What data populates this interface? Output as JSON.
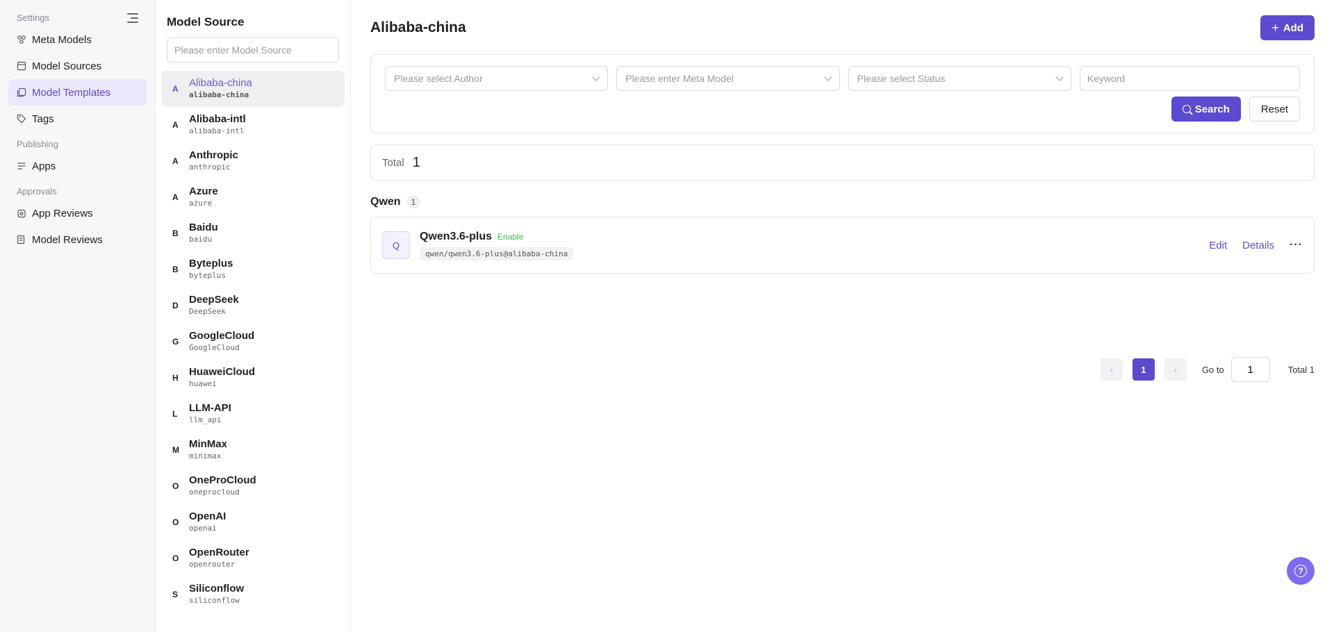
{
  "nav": {
    "settings_label": "Settings",
    "publishing_label": "Publishing",
    "approvals_label": "Approvals",
    "items": {
      "meta_models": "Meta Models",
      "model_sources": "Model Sources",
      "model_templates": "Model Templates",
      "tags": "Tags",
      "apps": "Apps",
      "app_reviews": "App Reviews",
      "model_reviews": "Model Reviews"
    },
    "active": "Model Templates"
  },
  "source_panel": {
    "title": "Model Source",
    "search_placeholder": "Please enter Model Source",
    "sources": [
      {
        "letter": "A",
        "name": "Alibaba-china",
        "code": "alibaba-china",
        "active": true
      },
      {
        "letter": "A",
        "name": "Alibaba-intl",
        "code": "alibaba-intl"
      },
      {
        "letter": "A",
        "name": "Anthropic",
        "code": "anthropic"
      },
      {
        "letter": "A",
        "name": "Azure",
        "code": "azure"
      },
      {
        "letter": "B",
        "name": "Baidu",
        "code": "baidu"
      },
      {
        "letter": "B",
        "name": "Byteplus",
        "code": "byteplus"
      },
      {
        "letter": "D",
        "name": "DeepSeek",
        "code": "DeepSeek"
      },
      {
        "letter": "G",
        "name": "GoogleCloud",
        "code": "GoogleCloud"
      },
      {
        "letter": "H",
        "name": "HuaweiCloud",
        "code": "huawei"
      },
      {
        "letter": "L",
        "name": "LLM-API",
        "code": "llm_api"
      },
      {
        "letter": "M",
        "name": "MinMax",
        "code": "minimax"
      },
      {
        "letter": "O",
        "name": "OneProCloud",
        "code": "oneprocloud"
      },
      {
        "letter": "O",
        "name": "OpenAI",
        "code": "openai"
      },
      {
        "letter": "O",
        "name": "OpenRouter",
        "code": "openrouter"
      },
      {
        "letter": "S",
        "name": "Siliconflow",
        "code": "siliconflow"
      }
    ]
  },
  "main": {
    "title": "Alibaba-china",
    "add_label": "Add",
    "filters": {
      "author_placeholder": "Please select Author",
      "meta_model_placeholder": "Please enter Meta Model",
      "status_placeholder": "Please select Status",
      "keyword_placeholder": "Keyword",
      "search_label": "Search",
      "reset_label": "Reset"
    },
    "total_label": "Total",
    "total_value": "1",
    "groups": [
      {
        "name": "Qwen",
        "count": "1",
        "models": [
          {
            "avatar": "Q",
            "name": "Qwen3.6-plus",
            "status": "Enable",
            "code": "qwen/qwen3.6-plus@alibaba-china",
            "edit_label": "Edit",
            "details_label": "Details",
            "more_label": "···"
          }
        ]
      }
    ],
    "pagination": {
      "prev": "‹",
      "current": "1",
      "next": "›",
      "goto_label": "Go to",
      "goto_value": "1",
      "total_text": "Total 1"
    },
    "help_icon": "?"
  },
  "colors": {
    "accent": "#5b4bd1",
    "active_bg": "#ebe8fb",
    "enable_green": "#3fb94f"
  }
}
